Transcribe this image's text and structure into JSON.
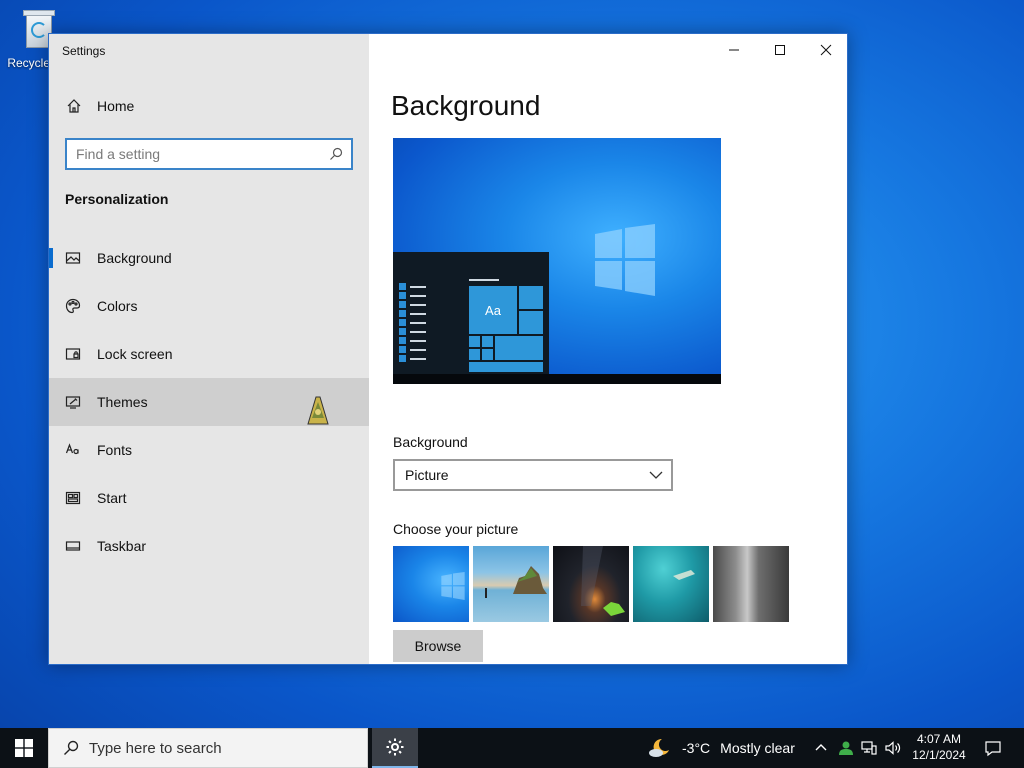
{
  "desktop": {
    "icon_label": "Recycle Bin"
  },
  "window": {
    "title": "Settings",
    "sidebar": {
      "home_label": "Home",
      "search_placeholder": "Find a setting",
      "section_title": "Personalization",
      "items": [
        {
          "label": "Background",
          "icon": "picture-icon"
        },
        {
          "label": "Colors",
          "icon": "palette-icon"
        },
        {
          "label": "Lock screen",
          "icon": "lock-screen-icon"
        },
        {
          "label": "Themes",
          "icon": "themes-icon"
        },
        {
          "label": "Fonts",
          "icon": "fonts-icon"
        },
        {
          "label": "Start",
          "icon": "start-icon"
        },
        {
          "label": "Taskbar",
          "icon": "taskbar-icon"
        }
      ],
      "selected": "Background",
      "hovered": "Themes"
    },
    "content": {
      "page_title": "Background",
      "preview_tile_text": "Aa",
      "background_label": "Background",
      "background_value": "Picture",
      "choose_label": "Choose your picture",
      "browse_label": "Browse"
    }
  },
  "taskbar": {
    "search_placeholder": "Type here to search",
    "weather": {
      "temp": "-3°C",
      "condition": "Mostly clear"
    },
    "clock": {
      "time": "4:07 AM",
      "date": "12/1/2024"
    }
  },
  "colors": {
    "accent": "#0a6cce",
    "sidebar_bg": "#e6e6e6",
    "taskbar_bg": "#0c1116"
  }
}
